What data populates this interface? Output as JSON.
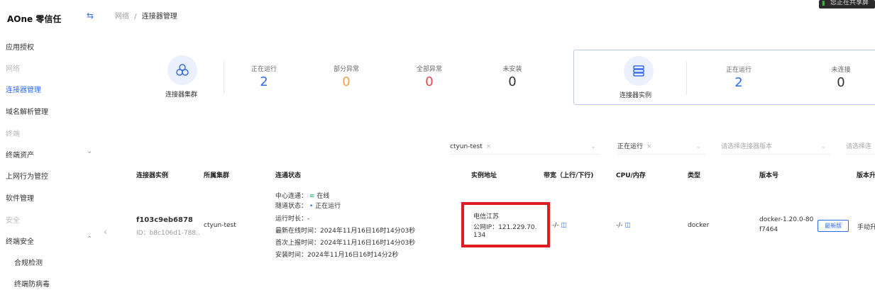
{
  "brand": "AOne 零信任",
  "sidebar": {
    "items": [
      {
        "label": "应用授权",
        "type": "item"
      },
      {
        "label": "网络",
        "type": "group"
      },
      {
        "label": "连接器管理",
        "type": "active"
      },
      {
        "label": "域名解析管理",
        "type": "item"
      },
      {
        "label": "终端",
        "type": "group"
      },
      {
        "label": "终端资产",
        "type": "item",
        "chevron": "chevron-down-icon"
      },
      {
        "label": "上网行为管控",
        "type": "item"
      },
      {
        "label": "软件管理",
        "type": "item"
      },
      {
        "label": "安全",
        "type": "group"
      },
      {
        "label": "终端安全",
        "type": "item",
        "chevron": "chevron-up-icon"
      },
      {
        "label": "合规检测",
        "type": "sub"
      },
      {
        "label": "终端防病毒",
        "type": "sub"
      }
    ]
  },
  "breadcrumb": {
    "parent": "网络",
    "separator": "/",
    "current": "连接器管理"
  },
  "share_badge": "您正在共享屏",
  "cluster_card": {
    "label": "连接器集群",
    "icon": "cluster-icon",
    "stats": [
      {
        "label": "正在运行",
        "value": "2",
        "color": "#2f6cf0"
      },
      {
        "label": "部分异常",
        "value": "0",
        "color": "#f0a04b"
      },
      {
        "label": "全部异常",
        "value": "0",
        "color": "#e5484d"
      },
      {
        "label": "未安装",
        "value": "0",
        "color": "#333333"
      }
    ]
  },
  "instance_card": {
    "label": "连接器实例",
    "icon": "server-stack-icon",
    "stats": [
      {
        "label": "正在运行",
        "value": "2",
        "color": "#2f6cf0"
      },
      {
        "label": "未连接",
        "value": "0",
        "color": "#333333"
      }
    ]
  },
  "filters": {
    "cluster": "ctyun-test",
    "status": "正在运行",
    "version_placeholder": "请选择连接器版本",
    "more_placeholder": "请选择连"
  },
  "table": {
    "headers": [
      "连接器实例",
      "所属集群",
      "连通状态",
      "实例地址",
      "带宽（上行/下行)",
      "CPU/内存",
      "类型",
      "版本号",
      "版本升"
    ],
    "row": {
      "instance_name": "f103c9eb6878",
      "instance_id": "ID：b8c106d1-788..",
      "cluster": "ctyun-test",
      "status_lines": {
        "center_label": "中心连通：",
        "center_value": "在线",
        "tunnel_label": "隧道状态：",
        "tunnel_value": "正在运行",
        "runtime": "运行时长：-",
        "last_online": "最新在线时间：2024年11月16日16时14分03秒",
        "first_report": "首次上报时间：2024年11月16日16时14分03秒",
        "install_time": "安装时间：2024年11月16日16时14分2秒"
      },
      "address_region": "电信江苏",
      "address_ip_line1": "公网IP：121.229.70.",
      "address_ip_line2": "134",
      "bandwidth": "-/-",
      "cpu_mem": "-/-",
      "type": "docker",
      "version_line1": "docker-1.20.0-80",
      "version_line2": "f7464",
      "latest_button": "最新版",
      "upgrade": "手动升"
    }
  }
}
